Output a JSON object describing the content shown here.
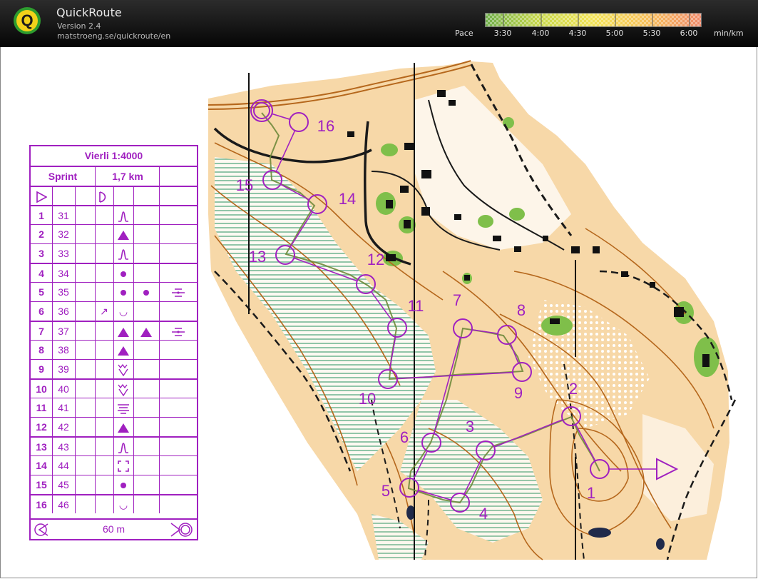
{
  "app": {
    "title": "QuickRoute",
    "version": "Version 2.4",
    "url": "matstroeng.se/quickroute/en",
    "logo_letter": "Q"
  },
  "pace": {
    "label": "Pace",
    "unit": "min/km",
    "ticks": [
      "3:30",
      "4:00",
      "4:30",
      "5:00",
      "5:30",
      "6:00"
    ],
    "colors": [
      "#6fae4a",
      "#c8d84a",
      "#f3e457",
      "#f7c05a",
      "#f08a6a"
    ]
  },
  "course": {
    "title": "Vierli 1:4000",
    "class_name": "Sprint",
    "length": "1,7 km",
    "finish_distance": "60 m",
    "controls": [
      {
        "num": "1",
        "code": "31",
        "d1": "",
        "d2": "knoll",
        "d3": "",
        "d4": ""
      },
      {
        "num": "2",
        "code": "32",
        "d1": "",
        "d2": "triangle",
        "d3": "",
        "d4": ""
      },
      {
        "num": "3",
        "code": "33",
        "d1": "",
        "d2": "knoll",
        "d3": "",
        "d4": ""
      },
      {
        "num": "4",
        "code": "34",
        "d1": "",
        "d2": "dot",
        "d3": "",
        "d4": ""
      },
      {
        "num": "5",
        "code": "35",
        "d1": "",
        "d2": "dot",
        "d3": "dot",
        "d4": "between"
      },
      {
        "num": "6",
        "code": "36",
        "d1": "↗",
        "d2": "◡",
        "d3": "",
        "d4": ""
      },
      {
        "num": "7",
        "code": "37",
        "d1": "",
        "d2": "triangle",
        "d3": "triangle",
        "d4": "between"
      },
      {
        "num": "8",
        "code": "38",
        "d1": "",
        "d2": "triangle",
        "d3": "",
        "d4": ""
      },
      {
        "num": "9",
        "code": "39",
        "d1": "",
        "d2": "ditch",
        "d3": "",
        "d4": ""
      },
      {
        "num": "10",
        "code": "40",
        "d1": "",
        "d2": "ditch",
        "d3": "",
        "d4": ""
      },
      {
        "num": "11",
        "code": "41",
        "d1": "",
        "d2": "marsh",
        "d3": "",
        "d4": ""
      },
      {
        "num": "12",
        "code": "42",
        "d1": "",
        "d2": "triangle",
        "d3": "",
        "d4": ""
      },
      {
        "num": "13",
        "code": "43",
        "d1": "",
        "d2": "knoll",
        "d3": "",
        "d4": ""
      },
      {
        "num": "14",
        "code": "44",
        "d1": "",
        "d2": "bracket",
        "d3": "",
        "d4": ""
      },
      {
        "num": "15",
        "code": "45",
        "d1": "",
        "d2": "dot",
        "d3": "",
        "d4": ""
      },
      {
        "num": "16",
        "code": "46",
        "d1": "",
        "d2": "◡",
        "d3": "",
        "d4": ""
      }
    ]
  },
  "map": {
    "control_labels": [
      "1",
      "2",
      "3",
      "4",
      "5",
      "6",
      "7",
      "8",
      "9",
      "10",
      "11",
      "12",
      "13",
      "14",
      "15",
      "16"
    ],
    "colors": {
      "course": "#a020c0",
      "open": "#f7d8a8",
      "forest": "#ffffff",
      "vegetation": "#7fbf6a",
      "contour": "#b5671c",
      "water": "#4aa0c8"
    }
  }
}
